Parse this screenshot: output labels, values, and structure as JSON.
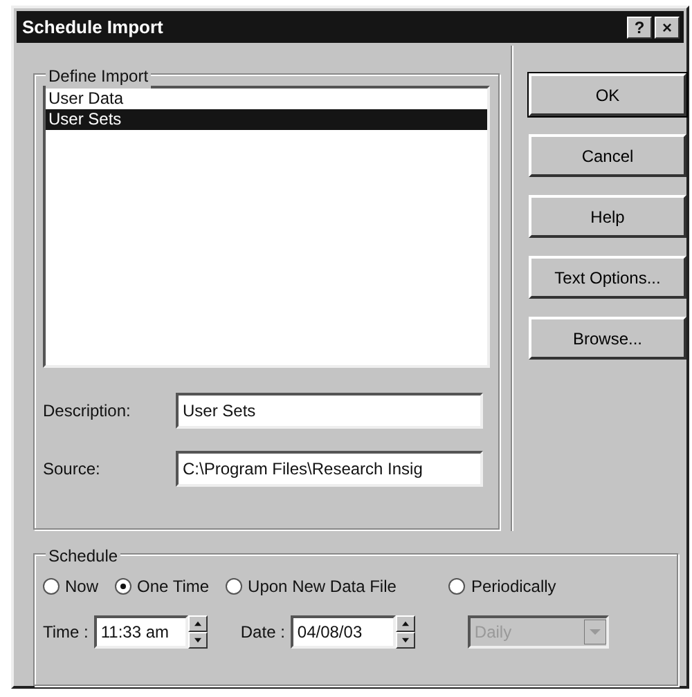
{
  "window": {
    "title": "Schedule Import",
    "controls": [
      "?",
      "×"
    ]
  },
  "define_import": {
    "label": "Define Import",
    "items": [
      {
        "label": "User Data",
        "selected": false
      },
      {
        "label": "User Sets",
        "selected": true
      }
    ]
  },
  "fields": [
    {
      "label": "Description:",
      "value": "User Sets"
    },
    {
      "label": "Source:",
      "value": "C:\\Program Files\\Research Insig"
    }
  ],
  "buttons": [
    {
      "label": "OK",
      "default": true
    },
    {
      "label": "Cancel",
      "default": false
    },
    {
      "label": "Help",
      "default": false
    },
    {
      "label": "Text Options...",
      "default": false
    },
    {
      "label": "Browse...",
      "default": false
    }
  ],
  "schedule": {
    "label": "Schedule",
    "options": [
      {
        "label": "Now",
        "selected": false
      },
      {
        "label": "One Time",
        "selected": true
      },
      {
        "label": "Upon New Data File",
        "selected": false
      },
      {
        "label": "Periodically",
        "selected": false
      }
    ],
    "time": {
      "label": "Time :",
      "value": "11:33 am"
    },
    "date": {
      "label": "Date :",
      "value": "04/08/03"
    },
    "frequency": {
      "value": "Daily",
      "disabled": true
    }
  }
}
